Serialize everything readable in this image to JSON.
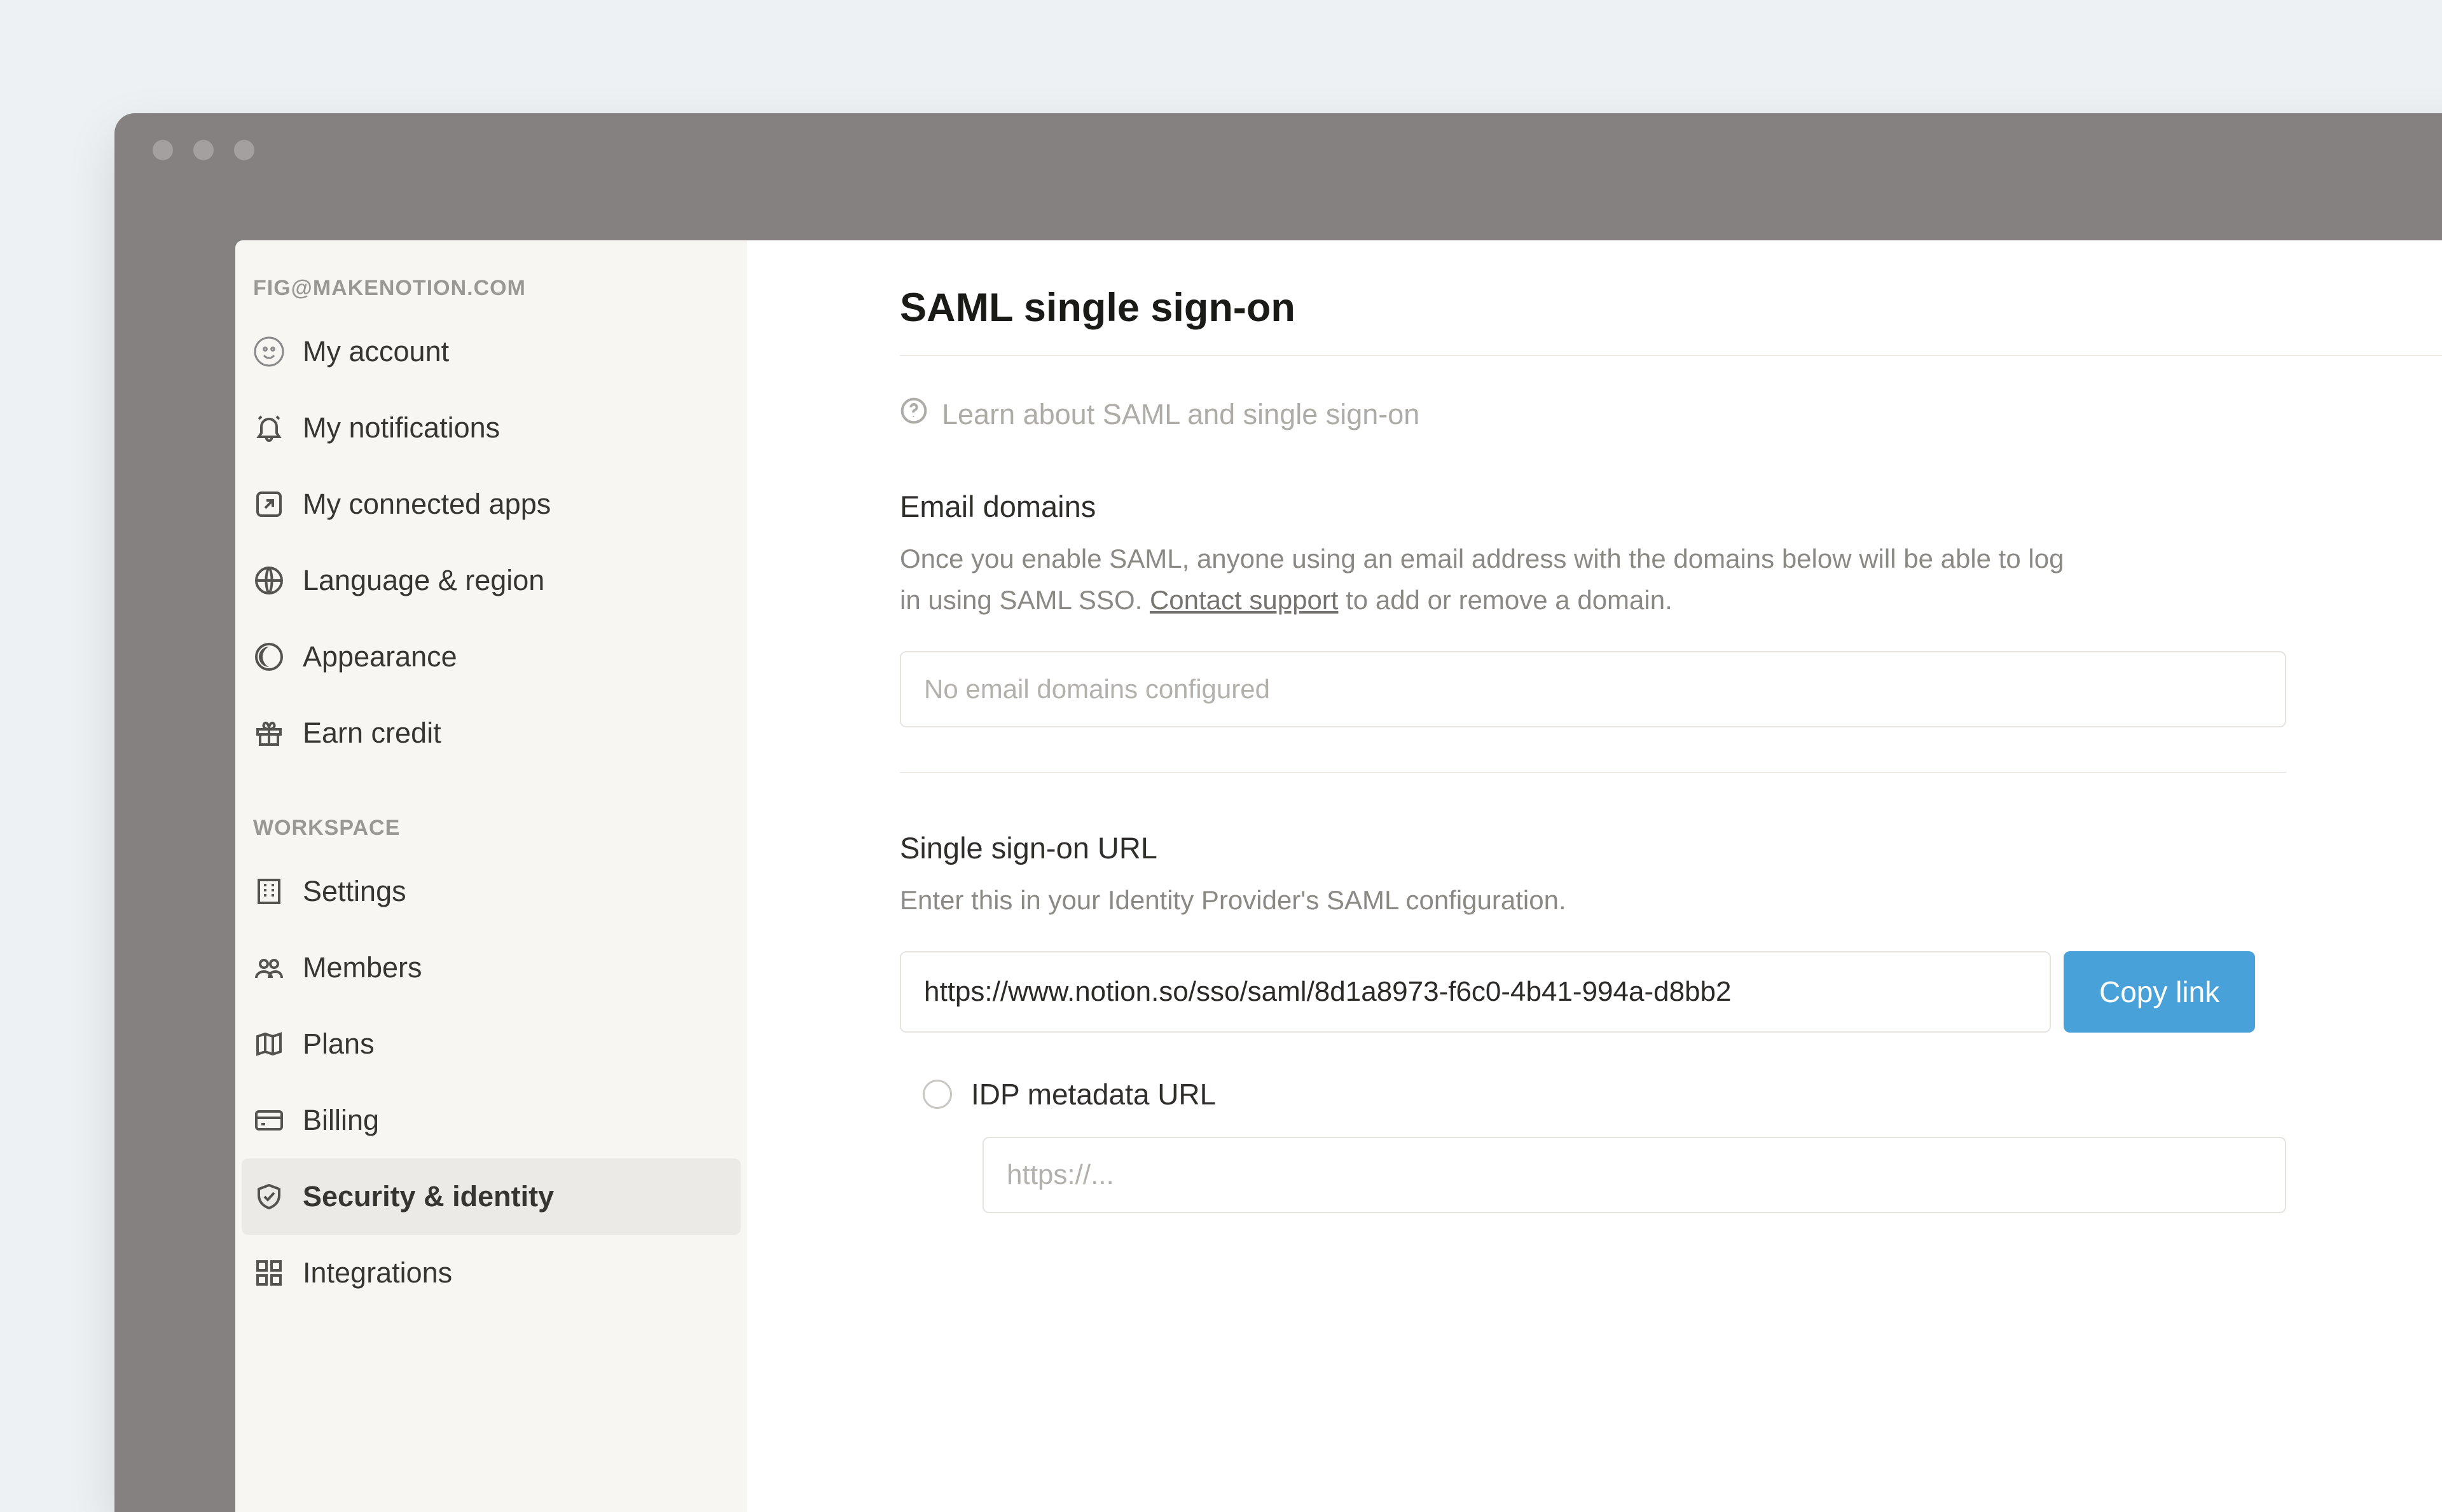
{
  "sidebar": {
    "user_label": "FIG@MAKENOTION.COM",
    "workspace_label": "WORKSPACE",
    "account_items": [
      {
        "label": "My account"
      },
      {
        "label": "My notifications"
      },
      {
        "label": "My connected apps"
      },
      {
        "label": "Language & region"
      },
      {
        "label": "Appearance"
      },
      {
        "label": "Earn credit"
      }
    ],
    "workspace_items": [
      {
        "label": "Settings"
      },
      {
        "label": "Members"
      },
      {
        "label": "Plans"
      },
      {
        "label": "Billing"
      },
      {
        "label": "Security & identity"
      },
      {
        "label": "Integrations"
      }
    ]
  },
  "main": {
    "title": "SAML single sign-on",
    "learn_text": "Learn about SAML and single sign-on",
    "email_domains": {
      "heading": "Email domains",
      "desc_before": "Once you enable SAML, anyone using an email address with the domains below will be able to log in using SAML SSO. ",
      "contact_link": "Contact support",
      "desc_after": " to add or remove a domain.",
      "placeholder": "No email domains configured"
    },
    "sso_url": {
      "heading": "Single sign-on URL",
      "desc": "Enter this in your Identity Provider's SAML configuration.",
      "value": "https://www.notion.so/sso/saml/8d1a8973-f6c0-4b41-994a-d8bb2",
      "copy_label": "Copy link"
    },
    "idp": {
      "radio_label": "IDP metadata URL",
      "placeholder": "https://..."
    }
  }
}
